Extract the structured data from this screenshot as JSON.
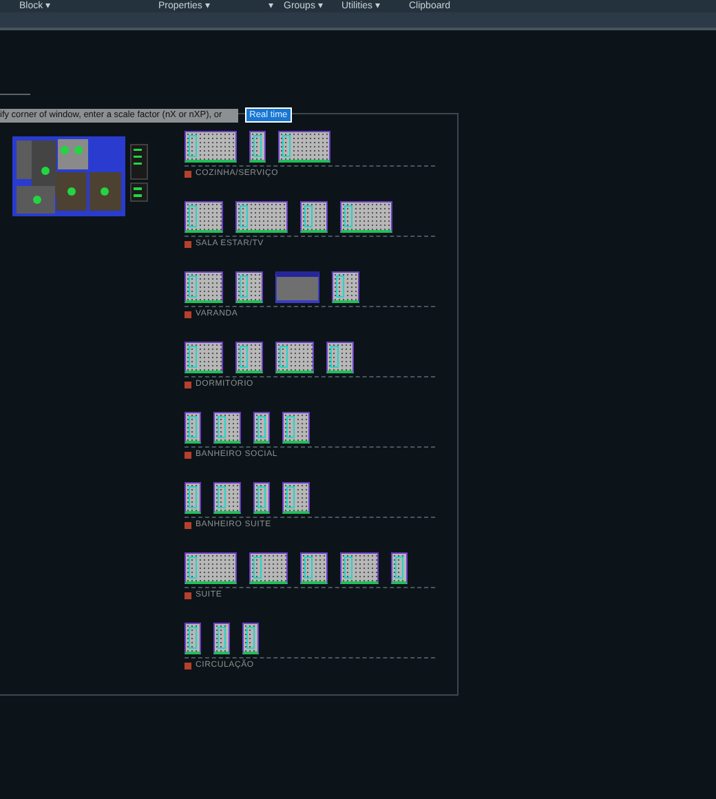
{
  "ribbon": {
    "panels": [
      {
        "label": "Block ▾"
      },
      {
        "label": "Properties ▾"
      },
      {
        "label": "▾"
      },
      {
        "label": "Groups ▾"
      },
      {
        "label": "Utilities ▾"
      },
      {
        "label": "Clipboard"
      }
    ]
  },
  "command_line": {
    "prompt": "ify corner of window, enter a scale factor (nX or nXP), or",
    "option": "Real time"
  },
  "sections": [
    {
      "title": "COZINHA/SERVIÇO",
      "elevations": [
        {
          "kind": "wide"
        },
        {
          "kind": "narrow"
        },
        {
          "kind": "wide"
        }
      ]
    },
    {
      "title": "SALA ESTAR/TV",
      "elevations": [
        {
          "kind": "medium"
        },
        {
          "kind": "wide"
        },
        {
          "kind": "square"
        },
        {
          "kind": "wide"
        }
      ]
    },
    {
      "title": "VARANDA",
      "elevations": [
        {
          "kind": "medium"
        },
        {
          "kind": "square"
        },
        {
          "kind": "dark"
        },
        {
          "kind": "square"
        }
      ]
    },
    {
      "title": "DORMITÓRIO",
      "elevations": [
        {
          "kind": "medium"
        },
        {
          "kind": "square"
        },
        {
          "kind": "medium"
        },
        {
          "kind": "square"
        }
      ]
    },
    {
      "title": "BANHEIRO SOCIAL",
      "elevations": [
        {
          "kind": "narrow"
        },
        {
          "kind": "square"
        },
        {
          "kind": "narrow"
        },
        {
          "kind": "square"
        }
      ]
    },
    {
      "title": "BANHEIRO SUITE",
      "elevations": [
        {
          "kind": "narrow"
        },
        {
          "kind": "square"
        },
        {
          "kind": "narrow"
        },
        {
          "kind": "square"
        }
      ]
    },
    {
      "title": "SUITE",
      "elevations": [
        {
          "kind": "wide"
        },
        {
          "kind": "medium"
        },
        {
          "kind": "square"
        },
        {
          "kind": "medium"
        },
        {
          "kind": "narrow"
        }
      ]
    },
    {
      "title": "CIRCULAÇÃO",
      "elevations": [
        {
          "kind": "narrow"
        },
        {
          "kind": "narrow"
        },
        {
          "kind": "narrow"
        }
      ]
    }
  ]
}
